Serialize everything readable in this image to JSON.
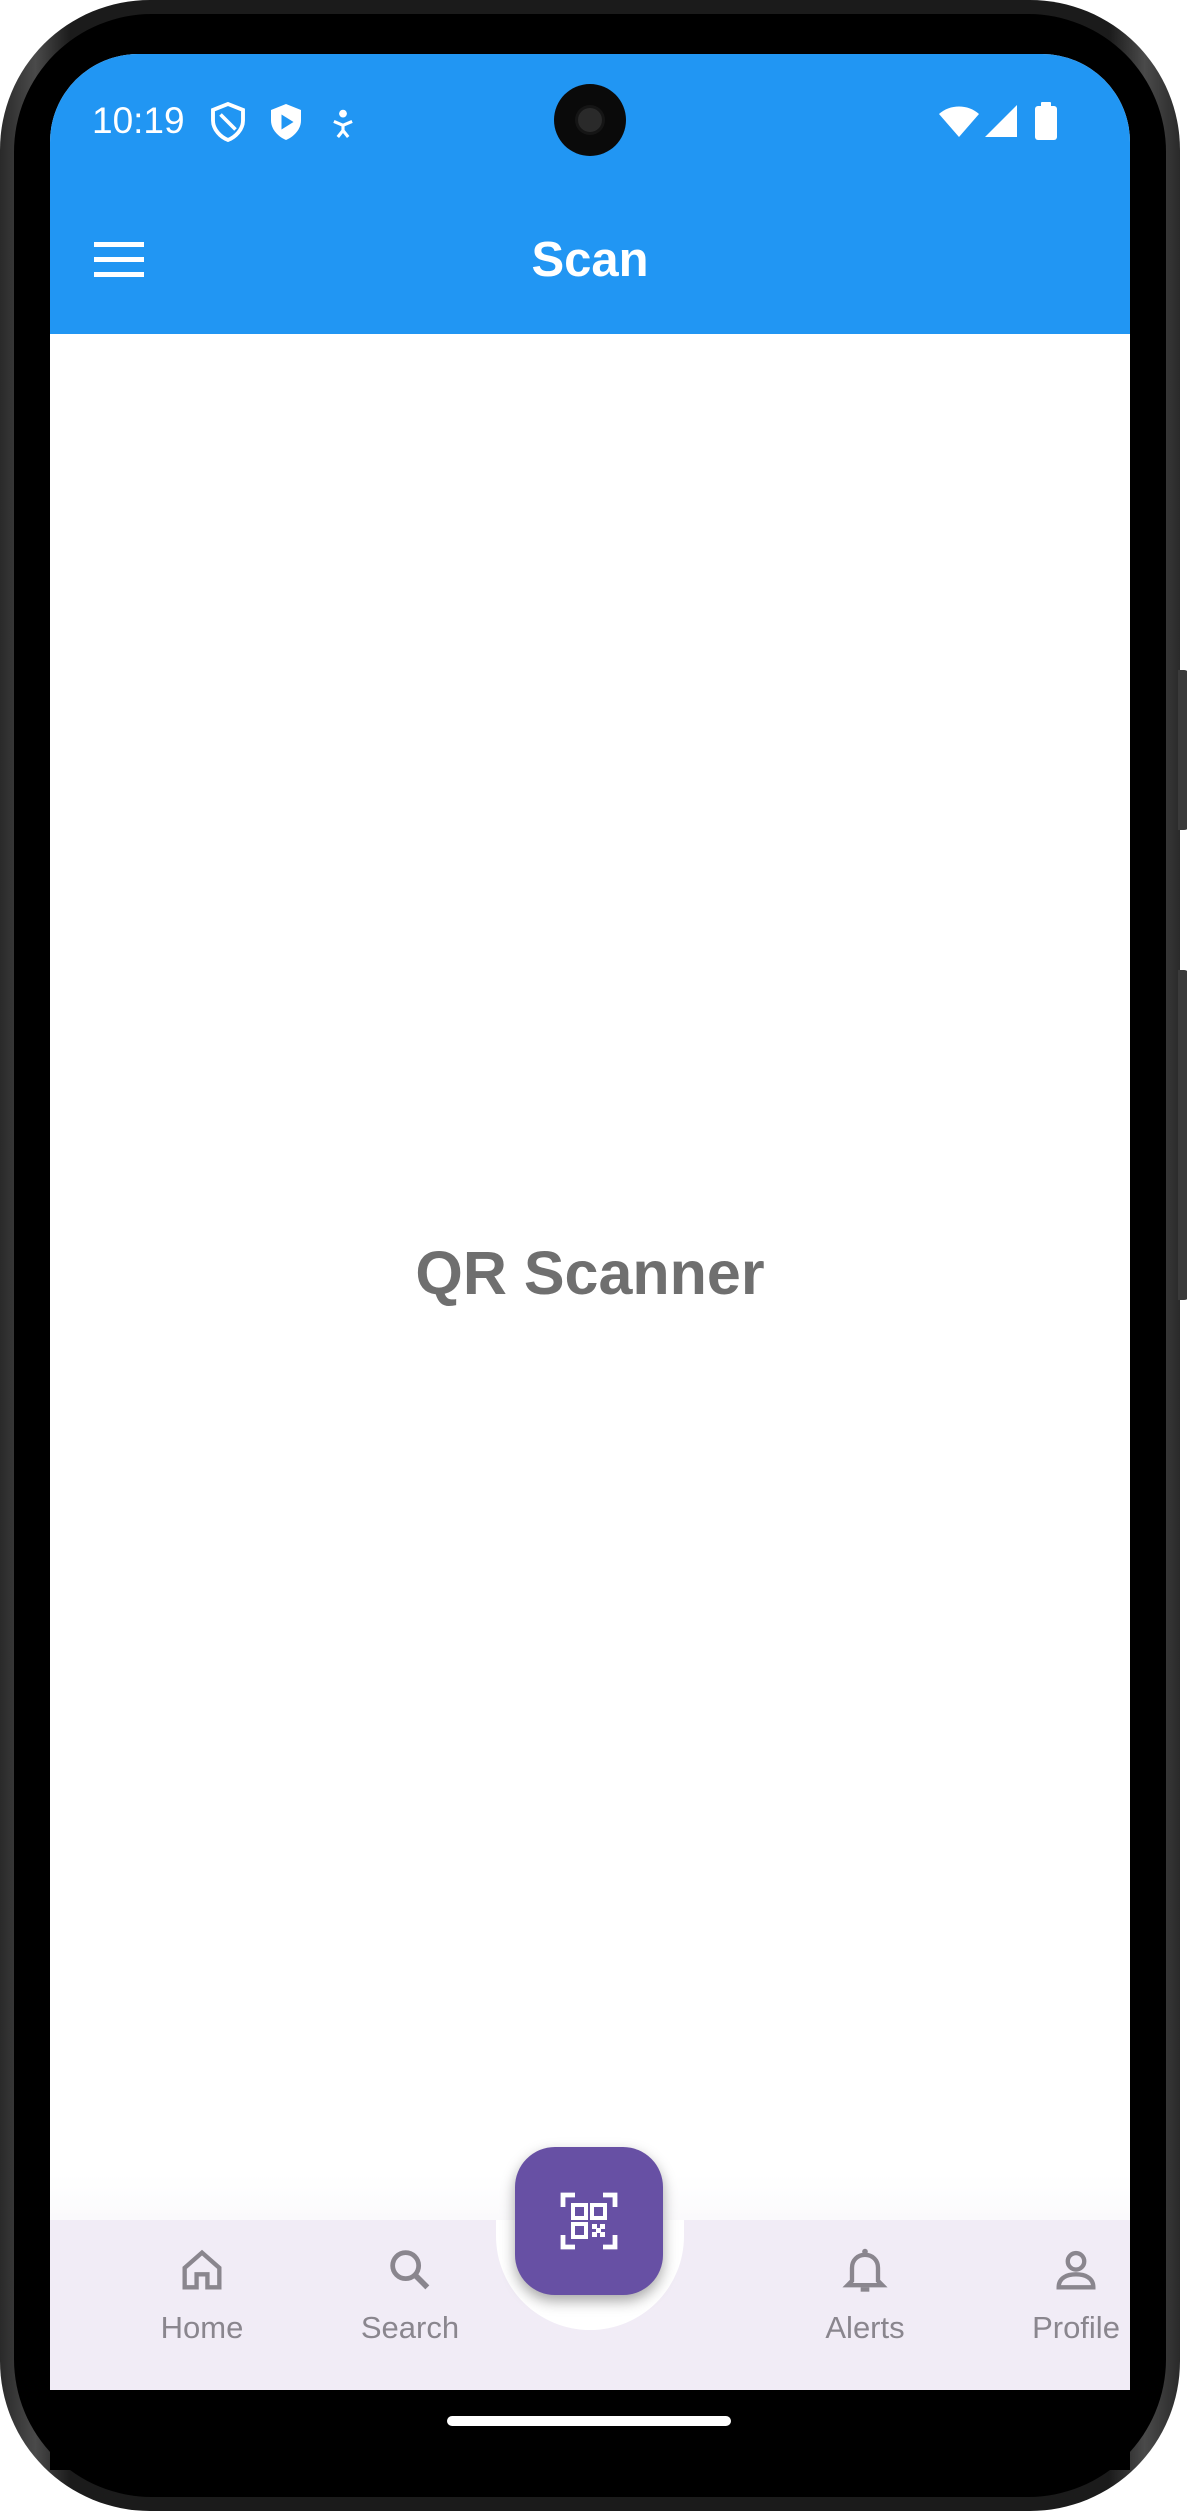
{
  "status_bar": {
    "time": "10:19",
    "left_icons": [
      "shield-outline-icon",
      "play-shield-icon",
      "accessibility-icon"
    ],
    "right_icons": [
      "wifi-icon",
      "signal-icon",
      "battery-icon"
    ]
  },
  "app_bar": {
    "title": "Scan",
    "menu_icon": "hamburger-menu-icon",
    "color": "#2196F3"
  },
  "main": {
    "text": "QR Scanner"
  },
  "bottom_nav": {
    "items": [
      {
        "label": "Home",
        "icon": "home-icon"
      },
      {
        "label": "Search",
        "icon": "search-icon"
      },
      {
        "label": "Alerts",
        "icon": "bell-icon"
      },
      {
        "label": "Profile",
        "icon": "person-icon"
      }
    ],
    "fab_icon": "qr-scan-icon",
    "fab_color": "#6750A4",
    "background": "#f1ecf6"
  }
}
